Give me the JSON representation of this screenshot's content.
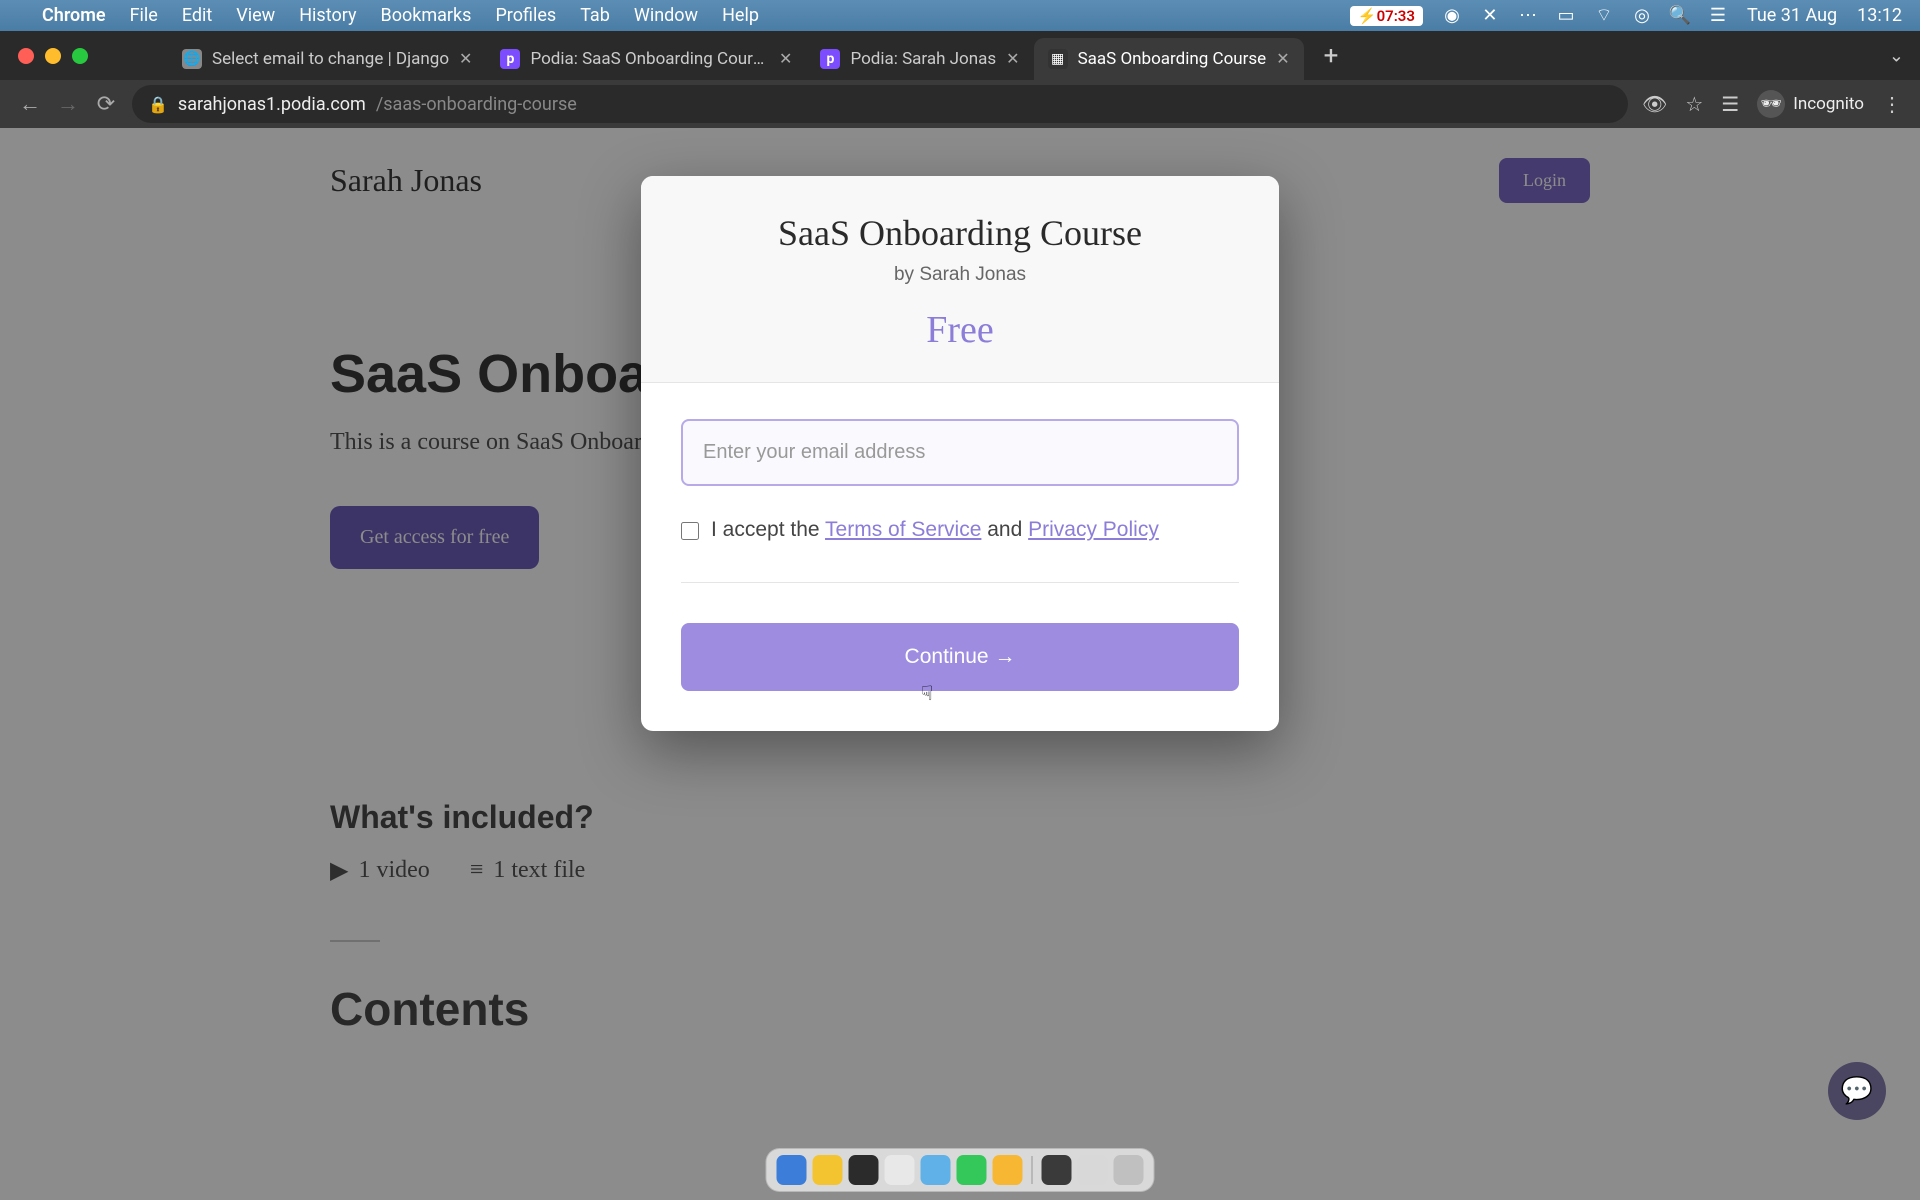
{
  "menubar": {
    "app": "Chrome",
    "items": [
      "File",
      "Edit",
      "View",
      "History",
      "Bookmarks",
      "Profiles",
      "Tab",
      "Window",
      "Help"
    ],
    "battery_time": "07:33",
    "date": "Tue 31 Aug",
    "clock": "13:12"
  },
  "tabs": [
    {
      "title": "Select email to change | Django",
      "favicon_bg": "#888",
      "favicon_txt": "🌐",
      "active": false
    },
    {
      "title": "Podia: SaaS Onboarding Course",
      "favicon_bg": "#7c4dff",
      "favicon_txt": "p",
      "active": false
    },
    {
      "title": "Podia: Sarah Jonas",
      "favicon_bg": "#7c4dff",
      "favicon_txt": "p",
      "active": false
    },
    {
      "title": "SaaS Onboarding Course",
      "favicon_bg": "#333",
      "favicon_txt": "▦",
      "active": true
    }
  ],
  "address": {
    "domain": "sarahjonas1.podia.com",
    "path": "/saas-onboarding-course"
  },
  "incognito_label": "Incognito",
  "page": {
    "brand": "Sarah Jonas",
    "login": "Login",
    "hero_title": "SaaS Onboarding Course",
    "hero_desc": "This is a course on SaaS Onboarding",
    "cta": "Get access for free",
    "included_h": "What's included?",
    "included_items": [
      "1 video",
      "1 text file"
    ],
    "contents_h": "Contents"
  },
  "modal": {
    "title": "SaaS Onboarding Course",
    "by": "by Sarah Jonas",
    "price": "Free",
    "email_placeholder": "Enter your email address",
    "accept_prefix": "I accept the ",
    "tos": "Terms of Service",
    "accept_mid": " and ",
    "privacy": "Privacy Policy",
    "continue": "Continue →"
  },
  "dock_colors": [
    "#3b7dd8",
    "#f4c430",
    "#2b2b2b",
    "#e8e8e8",
    "#5fb1e8",
    "#34c759",
    "#f7b733",
    "#3a3a3a",
    "#d8d8d8",
    "#c0c0c0"
  ]
}
